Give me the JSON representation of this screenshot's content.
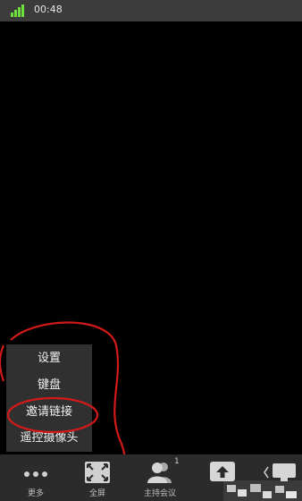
{
  "status_bar": {
    "time": "00:48"
  },
  "more_menu": {
    "items": [
      {
        "label": "设置"
      },
      {
        "label": "键盘"
      },
      {
        "label": "邀请链接"
      },
      {
        "label": "遥控摄像头"
      }
    ]
  },
  "toolbar": {
    "more_label": "更多",
    "fullscreen_label": "全屏",
    "host_label": "主持会议",
    "host_badge": "1"
  },
  "colors": {
    "signal": "#6ee03c",
    "annotation": "#d21a1a",
    "menu_bg": "#303030",
    "toolbar_bg": "#2b2b2b"
  }
}
